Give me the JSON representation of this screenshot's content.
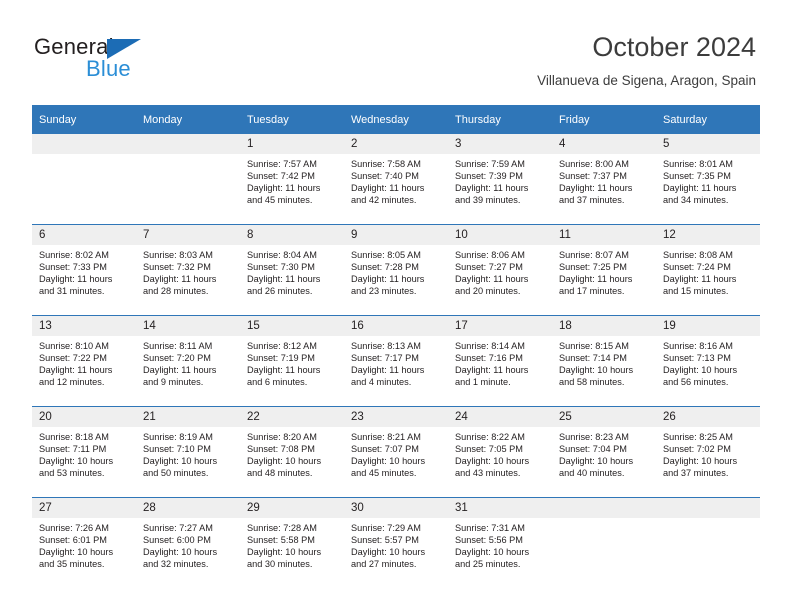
{
  "brand": {
    "word_general": "General",
    "word_blue": "Blue",
    "logo_icon": "triangle-icon",
    "accent_dark": "#1c6cb5",
    "accent_light": "#2b8ed6"
  },
  "header": {
    "title": "October 2024",
    "location": "Villanueva de Sigena, Aragon, Spain"
  },
  "theme": {
    "header_blue": "#2f76b8",
    "daynum_band": "#efefef",
    "text": "#231f20"
  },
  "calendar": {
    "weekday_headers": [
      "Sunday",
      "Monday",
      "Tuesday",
      "Wednesday",
      "Thursday",
      "Friday",
      "Saturday"
    ],
    "weeks": [
      [
        {
          "day": "",
          "lines": []
        },
        {
          "day": "",
          "lines": []
        },
        {
          "day": "1",
          "lines": [
            "Sunrise: 7:57 AM",
            "Sunset: 7:42 PM",
            "Daylight: 11 hours",
            "and 45 minutes."
          ]
        },
        {
          "day": "2",
          "lines": [
            "Sunrise: 7:58 AM",
            "Sunset: 7:40 PM",
            "Daylight: 11 hours",
            "and 42 minutes."
          ]
        },
        {
          "day": "3",
          "lines": [
            "Sunrise: 7:59 AM",
            "Sunset: 7:39 PM",
            "Daylight: 11 hours",
            "and 39 minutes."
          ]
        },
        {
          "day": "4",
          "lines": [
            "Sunrise: 8:00 AM",
            "Sunset: 7:37 PM",
            "Daylight: 11 hours",
            "and 37 minutes."
          ]
        },
        {
          "day": "5",
          "lines": [
            "Sunrise: 8:01 AM",
            "Sunset: 7:35 PM",
            "Daylight: 11 hours",
            "and 34 minutes."
          ]
        }
      ],
      [
        {
          "day": "6",
          "lines": [
            "Sunrise: 8:02 AM",
            "Sunset: 7:33 PM",
            "Daylight: 11 hours",
            "and 31 minutes."
          ]
        },
        {
          "day": "7",
          "lines": [
            "Sunrise: 8:03 AM",
            "Sunset: 7:32 PM",
            "Daylight: 11 hours",
            "and 28 minutes."
          ]
        },
        {
          "day": "8",
          "lines": [
            "Sunrise: 8:04 AM",
            "Sunset: 7:30 PM",
            "Daylight: 11 hours",
            "and 26 minutes."
          ]
        },
        {
          "day": "9",
          "lines": [
            "Sunrise: 8:05 AM",
            "Sunset: 7:28 PM",
            "Daylight: 11 hours",
            "and 23 minutes."
          ]
        },
        {
          "day": "10",
          "lines": [
            "Sunrise: 8:06 AM",
            "Sunset: 7:27 PM",
            "Daylight: 11 hours",
            "and 20 minutes."
          ]
        },
        {
          "day": "11",
          "lines": [
            "Sunrise: 8:07 AM",
            "Sunset: 7:25 PM",
            "Daylight: 11 hours",
            "and 17 minutes."
          ]
        },
        {
          "day": "12",
          "lines": [
            "Sunrise: 8:08 AM",
            "Sunset: 7:24 PM",
            "Daylight: 11 hours",
            "and 15 minutes."
          ]
        }
      ],
      [
        {
          "day": "13",
          "lines": [
            "Sunrise: 8:10 AM",
            "Sunset: 7:22 PM",
            "Daylight: 11 hours",
            "and 12 minutes."
          ]
        },
        {
          "day": "14",
          "lines": [
            "Sunrise: 8:11 AM",
            "Sunset: 7:20 PM",
            "Daylight: 11 hours",
            "and 9 minutes."
          ]
        },
        {
          "day": "15",
          "lines": [
            "Sunrise: 8:12 AM",
            "Sunset: 7:19 PM",
            "Daylight: 11 hours",
            "and 6 minutes."
          ]
        },
        {
          "day": "16",
          "lines": [
            "Sunrise: 8:13 AM",
            "Sunset: 7:17 PM",
            "Daylight: 11 hours",
            "and 4 minutes."
          ]
        },
        {
          "day": "17",
          "lines": [
            "Sunrise: 8:14 AM",
            "Sunset: 7:16 PM",
            "Daylight: 11 hours",
            "and 1 minute."
          ]
        },
        {
          "day": "18",
          "lines": [
            "Sunrise: 8:15 AM",
            "Sunset: 7:14 PM",
            "Daylight: 10 hours",
            "and 58 minutes."
          ]
        },
        {
          "day": "19",
          "lines": [
            "Sunrise: 8:16 AM",
            "Sunset: 7:13 PM",
            "Daylight: 10 hours",
            "and 56 minutes."
          ]
        }
      ],
      [
        {
          "day": "20",
          "lines": [
            "Sunrise: 8:18 AM",
            "Sunset: 7:11 PM",
            "Daylight: 10 hours",
            "and 53 minutes."
          ]
        },
        {
          "day": "21",
          "lines": [
            "Sunrise: 8:19 AM",
            "Sunset: 7:10 PM",
            "Daylight: 10 hours",
            "and 50 minutes."
          ]
        },
        {
          "day": "22",
          "lines": [
            "Sunrise: 8:20 AM",
            "Sunset: 7:08 PM",
            "Daylight: 10 hours",
            "and 48 minutes."
          ]
        },
        {
          "day": "23",
          "lines": [
            "Sunrise: 8:21 AM",
            "Sunset: 7:07 PM",
            "Daylight: 10 hours",
            "and 45 minutes."
          ]
        },
        {
          "day": "24",
          "lines": [
            "Sunrise: 8:22 AM",
            "Sunset: 7:05 PM",
            "Daylight: 10 hours",
            "and 43 minutes."
          ]
        },
        {
          "day": "25",
          "lines": [
            "Sunrise: 8:23 AM",
            "Sunset: 7:04 PM",
            "Daylight: 10 hours",
            "and 40 minutes."
          ]
        },
        {
          "day": "26",
          "lines": [
            "Sunrise: 8:25 AM",
            "Sunset: 7:02 PM",
            "Daylight: 10 hours",
            "and 37 minutes."
          ]
        }
      ],
      [
        {
          "day": "27",
          "lines": [
            "Sunrise: 7:26 AM",
            "Sunset: 6:01 PM",
            "Daylight: 10 hours",
            "and 35 minutes."
          ]
        },
        {
          "day": "28",
          "lines": [
            "Sunrise: 7:27 AM",
            "Sunset: 6:00 PM",
            "Daylight: 10 hours",
            "and 32 minutes."
          ]
        },
        {
          "day": "29",
          "lines": [
            "Sunrise: 7:28 AM",
            "Sunset: 5:58 PM",
            "Daylight: 10 hours",
            "and 30 minutes."
          ]
        },
        {
          "day": "30",
          "lines": [
            "Sunrise: 7:29 AM",
            "Sunset: 5:57 PM",
            "Daylight: 10 hours",
            "and 27 minutes."
          ]
        },
        {
          "day": "31",
          "lines": [
            "Sunrise: 7:31 AM",
            "Sunset: 5:56 PM",
            "Daylight: 10 hours",
            "and 25 minutes."
          ]
        },
        {
          "day": "",
          "lines": []
        },
        {
          "day": "",
          "lines": []
        }
      ]
    ]
  }
}
